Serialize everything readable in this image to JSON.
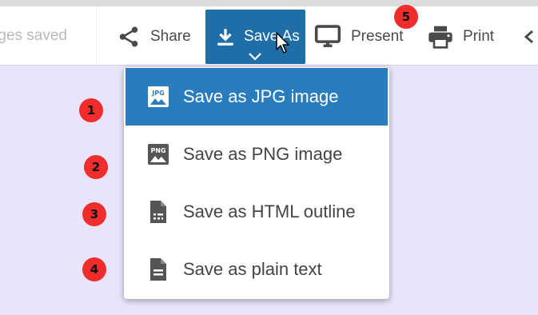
{
  "toolbar": {
    "status_text": "ges saved",
    "share_label": "Share",
    "saveas_label": "Save As",
    "present_label": "Present",
    "print_label": "Print"
  },
  "menu": {
    "items": [
      {
        "label": "Save as JPG image",
        "icon": "jpg-image-icon",
        "icon_text": "JPG",
        "active": true
      },
      {
        "label": "Save as PNG image",
        "icon": "png-image-icon",
        "icon_text": "PNG",
        "active": false
      },
      {
        "label": "Save as HTML outline",
        "icon": "html-outline-icon",
        "active": false
      },
      {
        "label": "Save as plain text",
        "icon": "text-document-icon",
        "active": false
      }
    ]
  },
  "badges": [
    "1",
    "2",
    "3",
    "4",
    "5"
  ],
  "colors": {
    "accent": "#1f6ea8",
    "menu_highlight": "#2a7dbd",
    "canvas": "#e9e4fb",
    "badge": "#ef2d2d"
  }
}
